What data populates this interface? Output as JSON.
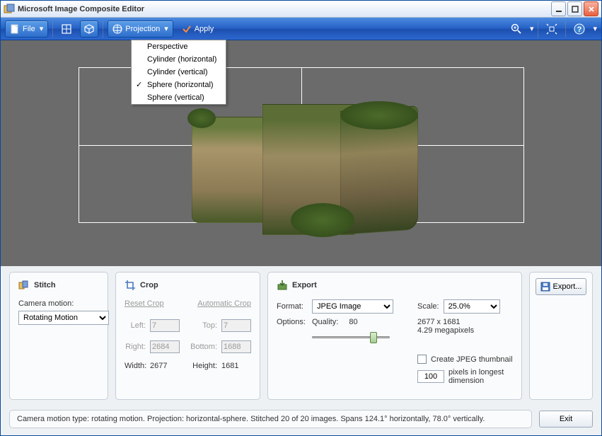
{
  "window": {
    "title": "Microsoft Image Composite Editor"
  },
  "toolbar": {
    "file": "File",
    "projection": "Projection",
    "apply": "Apply"
  },
  "dropdown": {
    "items": [
      "Perspective",
      "Cylinder (horizontal)",
      "Cylinder (vertical)",
      "Sphere (horizontal)",
      "Sphere (vertical)"
    ],
    "selected_index": 3
  },
  "stitch": {
    "title": "Stitch",
    "camera_motion_label": "Camera motion:",
    "camera_motion_value": "Rotating Motion"
  },
  "crop": {
    "title": "Crop",
    "reset": "Reset Crop",
    "auto": "Automatic Crop",
    "left_label": "Left:",
    "left": "7",
    "top_label": "Top:",
    "top": "7",
    "right_label": "Right:",
    "right": "2684",
    "bottom_label": "Bottom:",
    "bottom": "1688",
    "width_label": "Width:",
    "width": "2677",
    "height_label": "Height:",
    "height": "1681"
  },
  "export": {
    "title": "Export",
    "format_label": "Format:",
    "format_value": "JPEG Image",
    "options_label": "Options:",
    "quality_label": "Quality:",
    "quality_value": "80",
    "scale_label": "Scale:",
    "scale_value": "25.0%",
    "dims": "2677 x 1681",
    "mp": "4.29 megapixels",
    "thumb_label": "Create JPEG thumbnail",
    "thumb_px": "100",
    "thumb_suffix": "pixels in longest dimension",
    "button": "Export..."
  },
  "status": {
    "text": "Camera motion type: rotating motion. Projection: horizontal-sphere. Stitched 20 of 20 images. Spans 124.1° horizontally, 78.0° vertically.",
    "exit": "Exit"
  }
}
